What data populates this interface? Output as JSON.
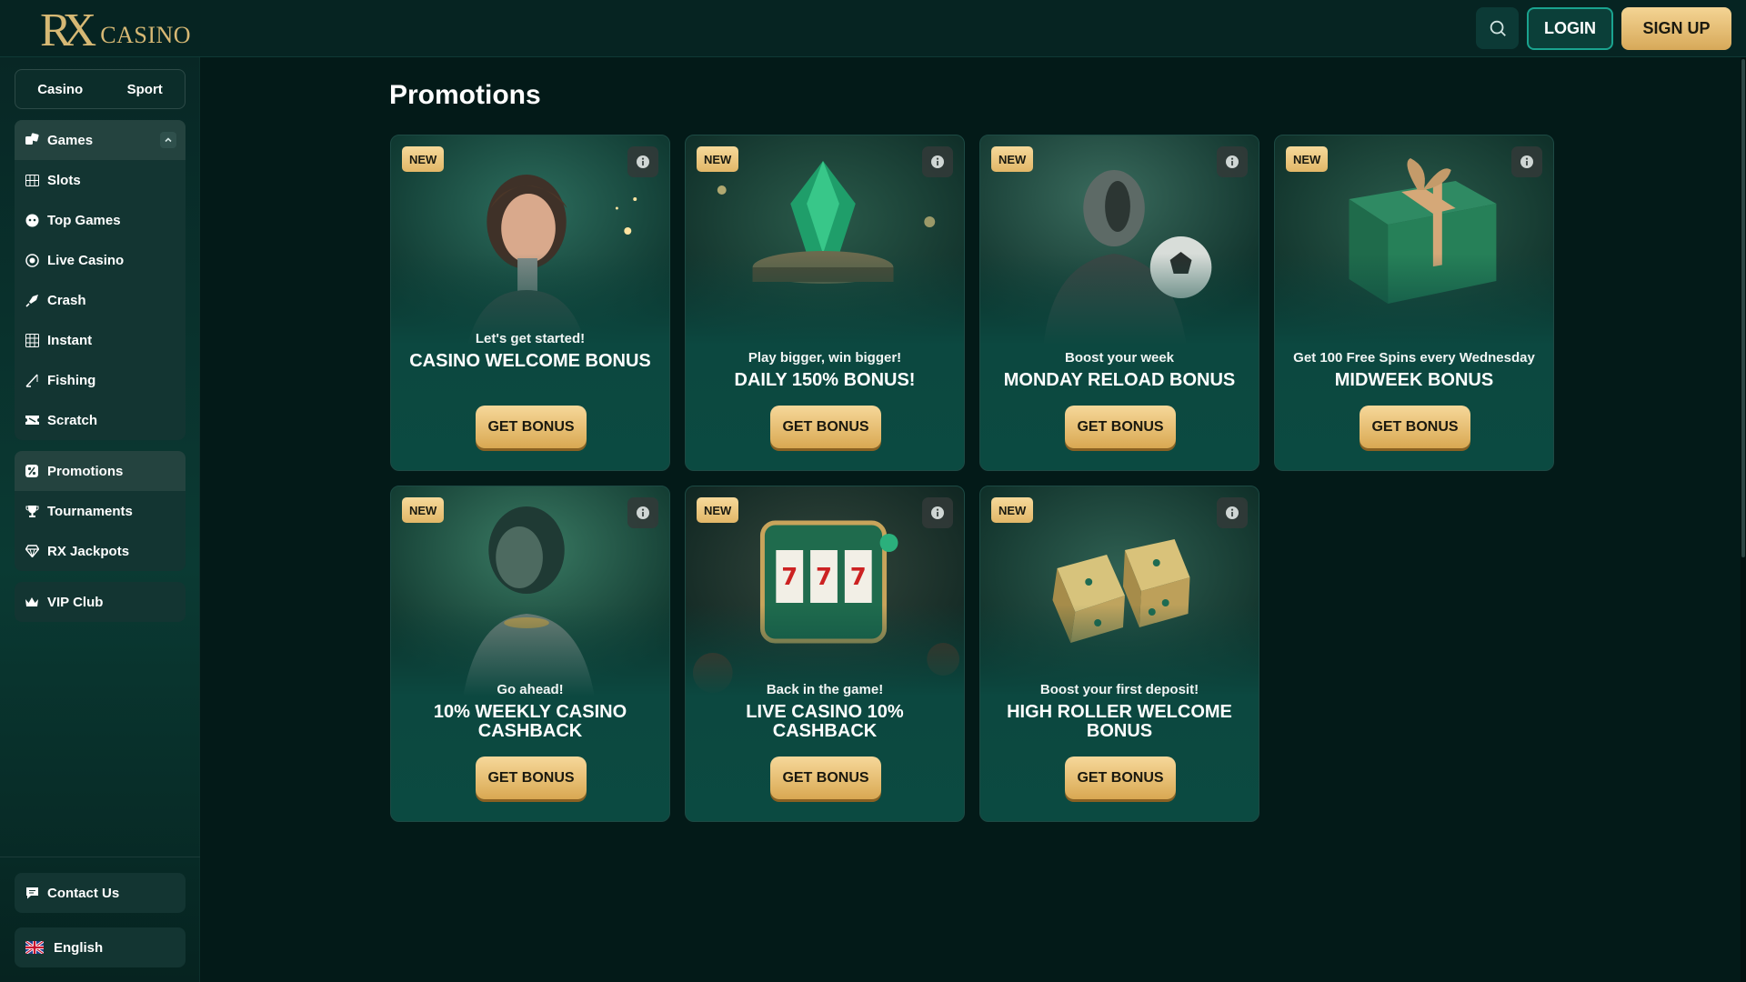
{
  "brand": {
    "logo_mark": "RX",
    "logo_word": "CASINO",
    "gold": "#d6b874"
  },
  "header": {
    "search_icon": "search-icon",
    "login_label": "LOGIN",
    "signup_label": "SIGN UP"
  },
  "sidebar": {
    "mode_tabs": [
      "Casino",
      "Sport"
    ],
    "games_group": {
      "header": {
        "label": "Games",
        "icon": "games-icon",
        "expanded": true
      },
      "items": [
        {
          "label": "Slots",
          "icon": "slots-icon"
        },
        {
          "label": "Top Games",
          "icon": "top-games-icon"
        },
        {
          "label": "Live Casino",
          "icon": "live-casino-icon"
        },
        {
          "label": "Crash",
          "icon": "crash-icon"
        },
        {
          "label": "Instant",
          "icon": "instant-icon"
        },
        {
          "label": "Fishing",
          "icon": "fishing-icon"
        },
        {
          "label": "Scratch",
          "icon": "scratch-icon"
        }
      ]
    },
    "promo_group": [
      {
        "label": "Promotions",
        "icon": "promotions-icon",
        "active": true
      },
      {
        "label": "Tournaments",
        "icon": "trophy-icon"
      },
      {
        "label": "RX Jackpots",
        "icon": "diamond-icon"
      }
    ],
    "vip": {
      "label": "VIP Club",
      "icon": "crown-icon"
    },
    "contact": {
      "label": "Contact Us",
      "icon": "chat-icon"
    },
    "language": {
      "label": "English",
      "icon": "uk-flag-icon"
    }
  },
  "main": {
    "title": "Promotions",
    "cards": [
      {
        "badge": "NEW",
        "subtitle": "Let's get started!",
        "title": "CASINO WELCOME BONUS",
        "button": "GET BONUS",
        "art": "robot-woman-art"
      },
      {
        "badge": "NEW",
        "subtitle": "Play bigger, win bigger!",
        "title": "DAILY 150% BONUS!",
        "button": "GET BONUS",
        "art": "emerald-gem-art"
      },
      {
        "badge": "NEW",
        "subtitle": "Boost your week",
        "title": "MONDAY RELOAD BONUS",
        "button": "GET BONUS",
        "art": "robot-football-art"
      },
      {
        "badge": "NEW",
        "subtitle": "Get 100 Free Spins every Wednesday",
        "title": "MIDWEEK BONUS",
        "button": "GET BONUS",
        "art": "gift-box-art"
      },
      {
        "badge": "NEW",
        "subtitle": "Go ahead!",
        "title": "10% WEEKLY CASINO CASHBACK",
        "button": "GET BONUS",
        "art": "robot-portrait-art"
      },
      {
        "badge": "NEW",
        "subtitle": "Back in the game!",
        "title": "LIVE CASINO 10% CASHBACK",
        "button": "GET BONUS",
        "art": "slot-machine-art"
      },
      {
        "badge": "NEW",
        "subtitle": "Boost your first deposit!",
        "title": "HIGH ROLLER WELCOME BONUS",
        "button": "GET BONUS",
        "art": "dice-art"
      }
    ]
  }
}
